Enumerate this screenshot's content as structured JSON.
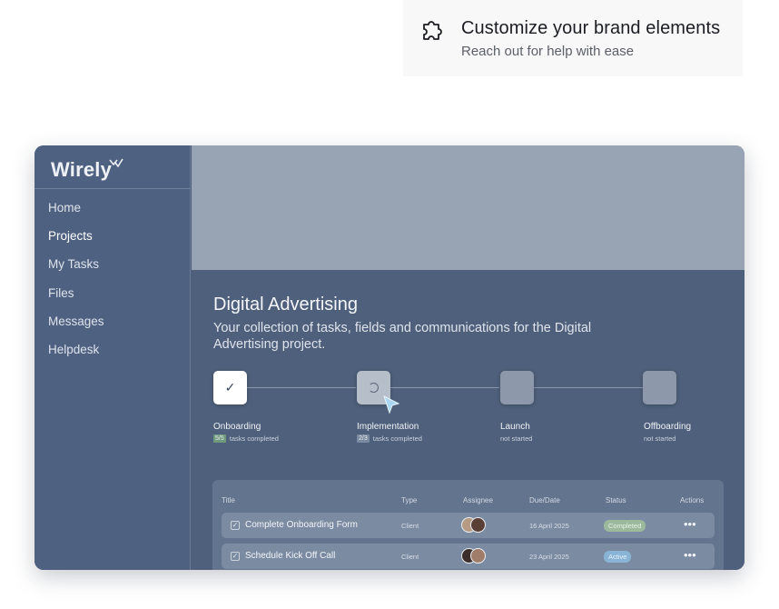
{
  "feature": {
    "icon": "puzzle-icon",
    "title": "Customize your brand elements",
    "subtitle": "Reach out for help with ease"
  },
  "app": {
    "logo": "Wirely",
    "nav": [
      {
        "label": "Home",
        "active": false
      },
      {
        "label": "Projects",
        "active": true
      },
      {
        "label": "My Tasks",
        "active": false
      },
      {
        "label": "Files",
        "active": false
      },
      {
        "label": "Messages",
        "active": false
      },
      {
        "label": "Helpdesk",
        "active": false
      }
    ],
    "page": {
      "title": "Digital Advertising",
      "description": "Your collection of tasks, fields and communications for the Digital Advertising project."
    },
    "steps": [
      {
        "label": "Onboarding",
        "count": "5/5",
        "meta": "tasks completed",
        "state": "done"
      },
      {
        "label": "Implementation",
        "count": "2/3",
        "meta": "tasks completed",
        "state": "current"
      },
      {
        "label": "Launch",
        "count": "",
        "meta": "not started",
        "state": "pending"
      },
      {
        "label": "Offboarding",
        "count": "",
        "meta": "not started",
        "state": "pending"
      }
    ],
    "table": {
      "headers": [
        "Title",
        "Type",
        "Assignee",
        "Due/Date",
        "Status",
        "Actions"
      ],
      "rows": [
        {
          "title": "Complete Onboarding Form",
          "type": "Client",
          "due": "16 April 2025",
          "status": "Completed",
          "actions": "•••"
        },
        {
          "title": "Schedule Kick Off Call",
          "type": "Client",
          "due": "23 April 2025",
          "status": "Active",
          "actions": "•••"
        }
      ]
    },
    "colors": {
      "sidebar": "#4f6180",
      "banner": "#98a3b3",
      "completed": "#9cb89d",
      "active": "#8ab4d6"
    }
  }
}
